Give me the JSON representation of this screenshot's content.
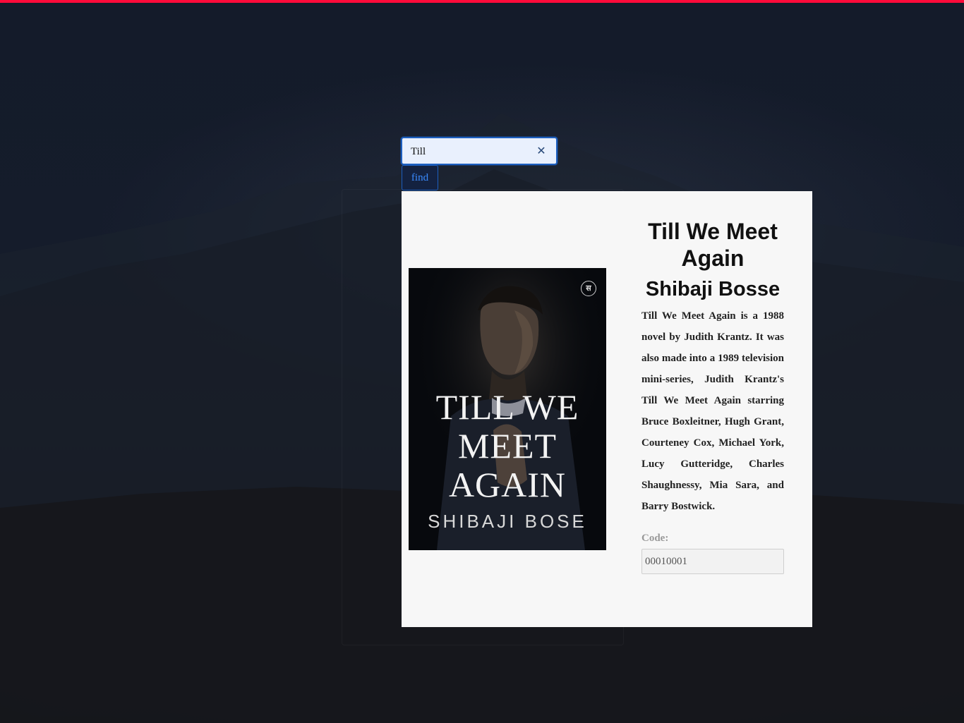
{
  "search": {
    "value": "Till",
    "clear_icon": "close-icon",
    "find_label": "find"
  },
  "book": {
    "title": "Till We Meet Again",
    "author": "Shibaji Bosse",
    "description": "Till We Meet Again is a 1988 novel by Judith Krantz. It was also made into a 1989 television mini-series, Judith Krantz's Till We Meet Again starring Bruce Boxleitner, Hugh Grant, Courteney Cox, Michael York, Lucy Gutteridge, Charles Shaughnessy, Mia Sara, and Barry Bostwick.",
    "code_label": "Code:",
    "code_value": "00010001",
    "cover": {
      "title_text": "TILL WE\nMEET\nAGAIN",
      "author_text": "SHIBAJI BOSE",
      "publisher_mark": "स"
    }
  },
  "colors": {
    "accent_bar": "#ff0a3a",
    "focus_border": "#1d5fbf",
    "find_text": "#3a8bff",
    "card_background": "#f7f7f7"
  }
}
